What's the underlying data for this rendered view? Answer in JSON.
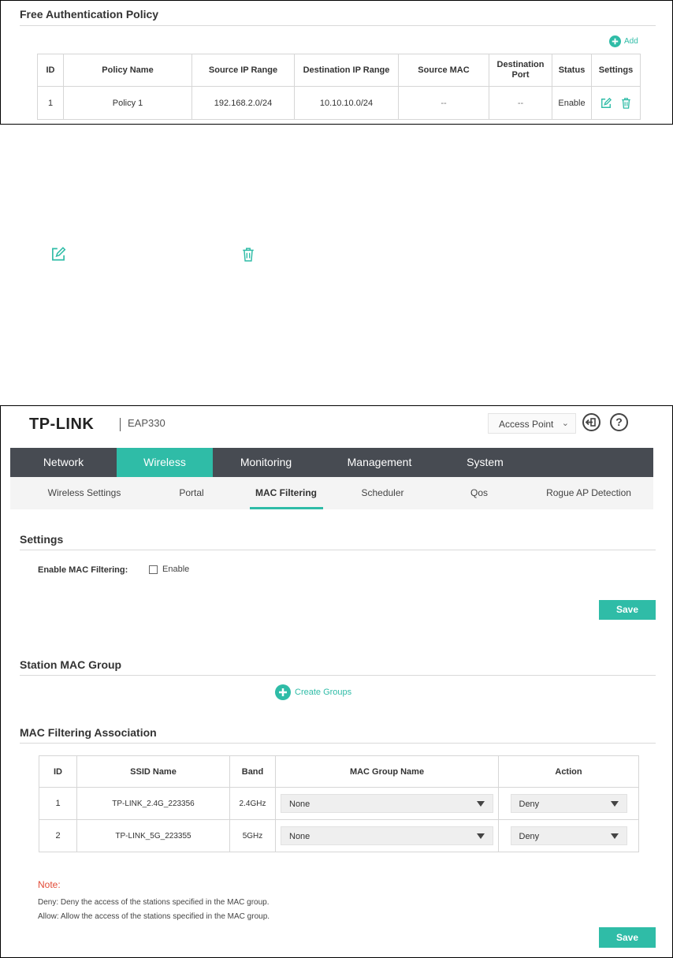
{
  "policy_panel": {
    "title": "Free Authentication Policy",
    "add_label": "Add",
    "columns": [
      "ID",
      "Policy Name",
      "Source IP Range",
      "Destination IP Range",
      "Source MAC",
      "Destination Port",
      "Status",
      "Settings"
    ],
    "rows": [
      {
        "id": "1",
        "name": "Policy 1",
        "src_ip": "192.168.2.0/24",
        "dst_ip": "10.10.10.0/24",
        "src_mac": "--",
        "dst_port": "--",
        "status": "Enable"
      }
    ]
  },
  "icons": {
    "edit": "edit-icon",
    "delete": "trash-icon",
    "accent_color": "#2fbca7"
  },
  "app": {
    "brand": "TP-LINK",
    "model": "EAP330",
    "mode": "Access Point",
    "main_nav": [
      "Network",
      "Wireless",
      "Monitoring",
      "Management",
      "System"
    ],
    "main_nav_active": "Wireless",
    "sub_nav": [
      "Wireless Settings",
      "Portal",
      "MAC Filtering",
      "Scheduler",
      "Qos",
      "Rogue AP Detection"
    ],
    "sub_nav_active": "MAC Filtering",
    "nav_bg": "#474b52"
  },
  "settings": {
    "title": "Settings",
    "enable_label": "Enable MAC Filtering:",
    "checkbox_label": "Enable",
    "checked": false,
    "save": "Save"
  },
  "station_group": {
    "title": "Station MAC Group",
    "create_label": "Create Groups"
  },
  "association": {
    "title": "MAC Filtering Association",
    "columns": [
      "ID",
      "SSID Name",
      "Band",
      "MAC Group Name",
      "Action"
    ],
    "rows": [
      {
        "id": "1",
        "ssid": "TP-LINK_2.4G_223356",
        "band": "2.4GHz",
        "group": "None",
        "action": "Deny"
      },
      {
        "id": "2",
        "ssid": "TP-LINK_5G_223355",
        "band": "5GHz",
        "group": "None",
        "action": "Deny"
      }
    ],
    "note_title": "Note:",
    "note_deny": "Deny: Deny the access of the stations specified in the MAC group.",
    "note_allow": "Allow: Allow the access of the stations specified in the MAC group.",
    "save": "Save"
  }
}
